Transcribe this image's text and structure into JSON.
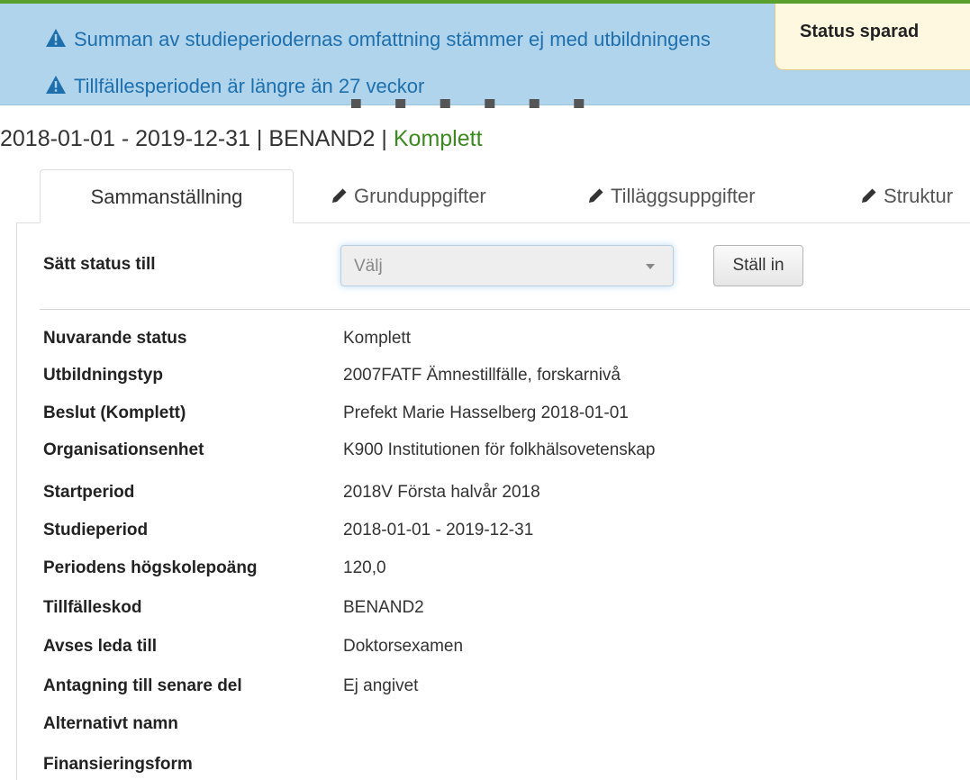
{
  "alerts": {
    "messages": [
      "Summan av studieperiodernas omfattning stämmer ej med utbildningens",
      "Tillfällesperioden är längre än 27 veckor"
    ]
  },
  "toast": {
    "text": "Status sparad"
  },
  "heading": {
    "text": "2018-01-01 - 2019-12-31 | BENAND2",
    "separator": " | ",
    "status": "Komplett",
    "status_color": "#3c8a1f"
  },
  "tabs": [
    {
      "label": "Sammanställning",
      "active": true
    },
    {
      "label": "Grunduppgifter",
      "icon": "pencil-icon"
    },
    {
      "label": "Tilläggsuppgifter",
      "icon": "pencil-icon"
    },
    {
      "label": "Struktur",
      "icon": "pencil-icon"
    }
  ],
  "status_form": {
    "label": "Sätt status till",
    "select_value": "Välj",
    "button_label": "Ställ in"
  },
  "details": [
    {
      "label": "Nuvarande status",
      "value": "Komplett"
    },
    {
      "label": "Utbildningstyp",
      "value": "2007FATF Ämnestillfälle, forskarnivå"
    },
    {
      "label": "Beslut (Komplett)",
      "value": "Prefekt Marie Hasselberg 2018-01-01"
    },
    {
      "label": "Organisationsenhet",
      "value": "K900 Institutionen för folkhälsovetenskap"
    },
    {
      "label": "Startperiod",
      "value": "2018V Första halvår 2018"
    },
    {
      "label": "Studieperiod",
      "value": "2018-01-01 - 2019-12-31"
    },
    {
      "label": "Periodens högskolepoäng",
      "value": "120,0"
    },
    {
      "label": "Tillfälleskod",
      "value": "BENAND2"
    },
    {
      "label": "Avses leda till",
      "value": "Doktorsexamen"
    },
    {
      "label": "Antagning till senare del",
      "value": "Ej angivet"
    },
    {
      "label": "Alternativt namn",
      "value": ""
    },
    {
      "label": "Finansieringsform",
      "value": ""
    }
  ],
  "colors": {
    "alert_bg": "#afd4eb",
    "alert_text": "#1e6fae",
    "toast_bg": "#fff8e1",
    "accent_green": "#5aa02c"
  }
}
